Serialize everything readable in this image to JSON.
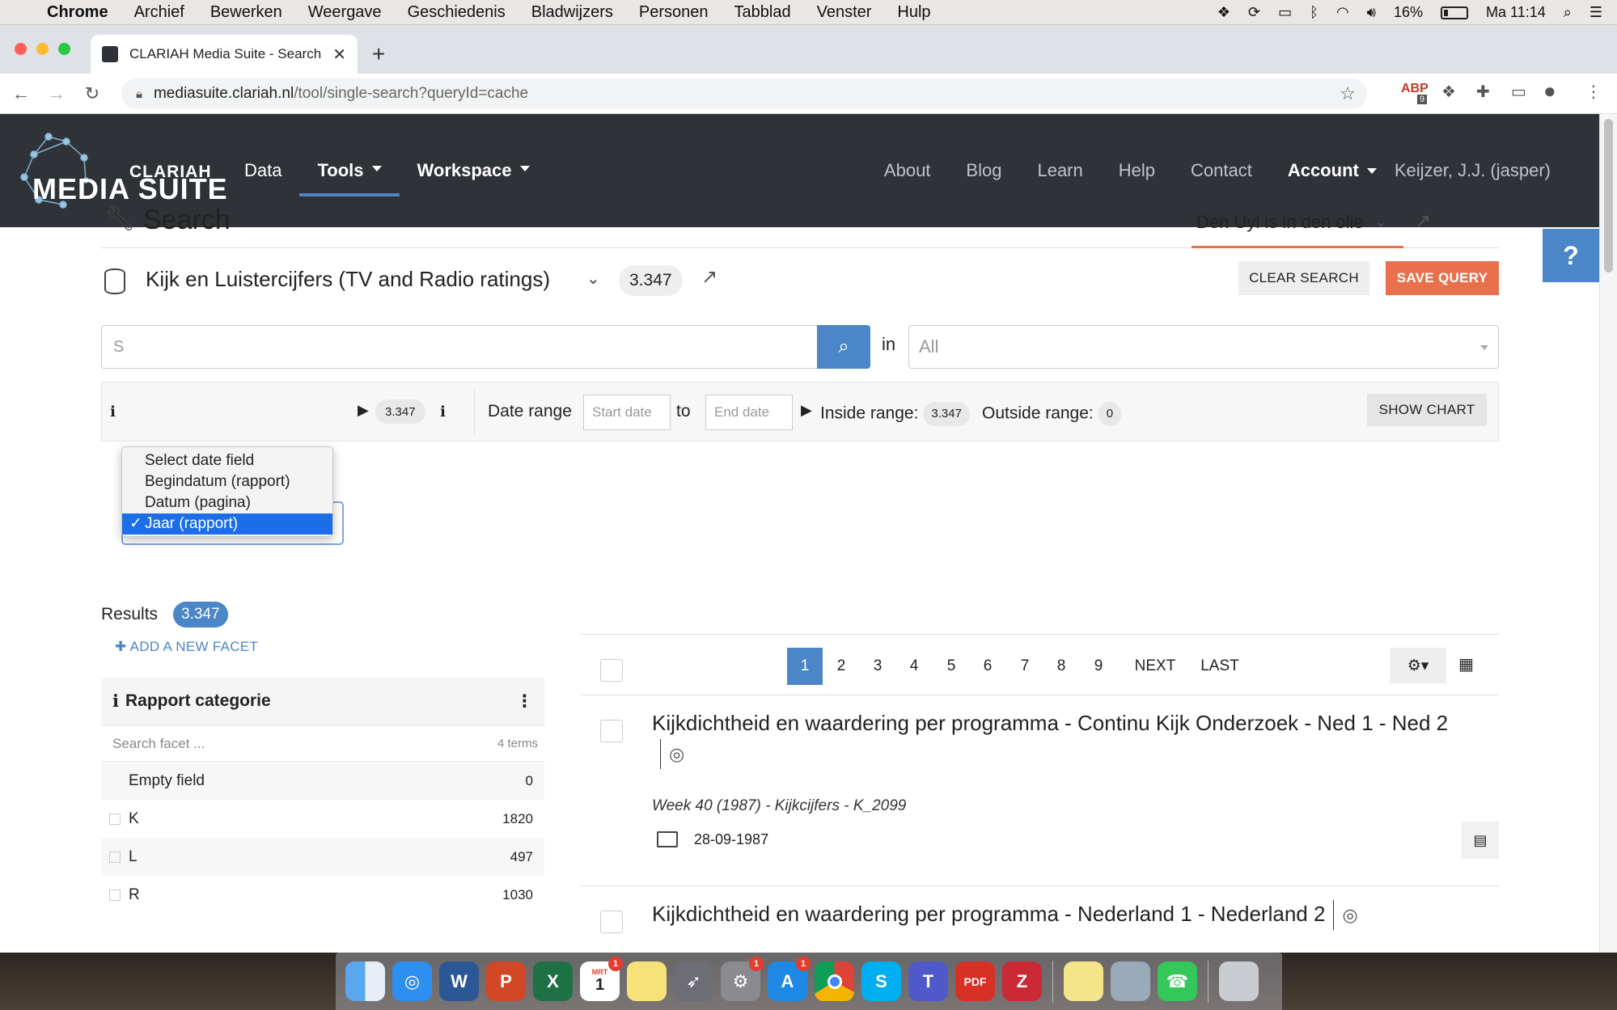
{
  "menubar": {
    "app": "Chrome",
    "items": [
      "Archief",
      "Bewerken",
      "Weergave",
      "Geschiedenis",
      "Bladwijzers",
      "Personen",
      "Tabblad",
      "Venster",
      "Hulp"
    ],
    "battery": "16%",
    "clock": "Ma 11:14"
  },
  "browser": {
    "tab_title": "CLARIAH Media Suite - Search",
    "url_host": "mediasuite.clariah.nl",
    "url_path": "/tool/single-search?queryId=cache",
    "ext_badge": "9"
  },
  "site": {
    "logo_top": "CLARIAH",
    "logo_main": "MEDIA SUITE",
    "nav_left": [
      {
        "label": "Data",
        "dropdown": false,
        "active": false
      },
      {
        "label": "Tools",
        "dropdown": true,
        "active": true
      },
      {
        "label": "Workspace",
        "dropdown": true,
        "active": false
      }
    ],
    "nav_right": [
      "About",
      "Blog",
      "Learn",
      "Help",
      "Contact"
    ],
    "account_label": "Account",
    "user_label": "Keijzer, J.J. (jasper)",
    "help_button": "?"
  },
  "search": {
    "title": "Search",
    "query_name": "Den Uyl is in den olie",
    "collection_name": "Kijk en Luistercijfers (TV and Radio ratings)",
    "collection_count": "3.347",
    "clear_label": "CLEAR SEARCH",
    "save_label": "SAVE QUERY",
    "input_placeholder": "S",
    "in_label": "in",
    "in_value": "All"
  },
  "date_filter": {
    "options": [
      "Select date field",
      "Begindatum (rapport)",
      "Datum (pagina)",
      "Jaar (rapport)"
    ],
    "selected": "Jaar (rapport)",
    "count": "3.347",
    "range_label": "Date range",
    "start_placeholder": "Start date",
    "to_label": "to",
    "end_placeholder": "End date",
    "inside_label": "Inside range:",
    "inside_count": "3.347",
    "outside_label": "Outside range:",
    "outside_count": "0",
    "chart_label": "SHOW CHART"
  },
  "results": {
    "label": "Results",
    "count": "3.347",
    "add_facet": "ADD A NEW FACET",
    "facet": {
      "title": "Rapport categorie",
      "search_placeholder": "Search facet ...",
      "terms": "4 terms",
      "rows": [
        {
          "label": "Empty field",
          "count": "0"
        },
        {
          "label": "K",
          "count": "1820"
        },
        {
          "label": "L",
          "count": "497"
        },
        {
          "label": "R",
          "count": "1030"
        }
      ]
    },
    "pagination": {
      "pages": [
        "1",
        "2",
        "3",
        "4",
        "5",
        "6",
        "7",
        "8",
        "9"
      ],
      "current": "1",
      "next": "NEXT",
      "last": "LAST"
    },
    "items": [
      {
        "title": "Kijkdichtheid en waardering per programma - Continu Kijk Onderzoek - Ned 1 - Ned 2",
        "subtitle": "Week 40 (1987) - Kijkcijfers - K_2099",
        "date": "28-09-1987"
      },
      {
        "title": "Kijkdichtheid en waardering per programma - Nederland 1 - Nederland 2",
        "subtitle": "",
        "date": ""
      }
    ]
  },
  "dock": {
    "icons": [
      "finder-icon",
      "safari-icon",
      "word-icon",
      "powerpoint-icon",
      "excel-icon",
      "calendar-icon",
      "notes-icon",
      "launchpad-icon",
      "system-preferences-icon",
      "app-store-icon",
      "chrome-icon",
      "skype-icon",
      "teams-icon",
      "pdf-icon",
      "zotero-icon",
      "stickies-icon",
      "preview-icon",
      "facetime-icon",
      "trash-icon"
    ],
    "calendar_month": "MRT",
    "calendar_day": "1"
  }
}
